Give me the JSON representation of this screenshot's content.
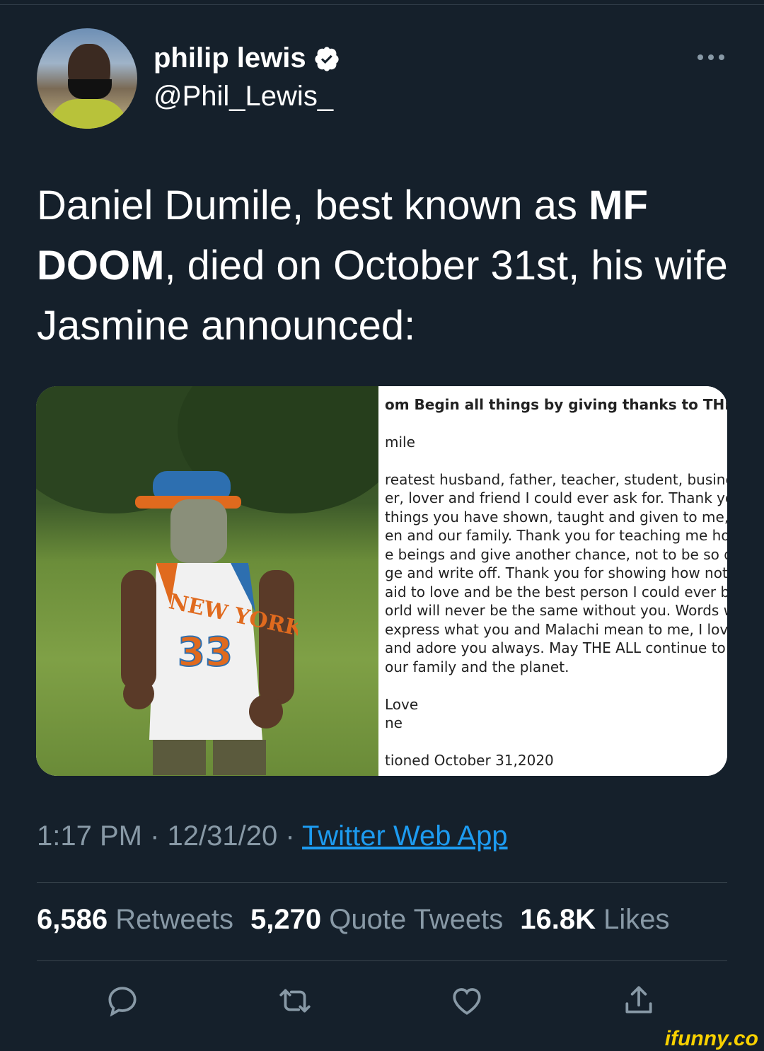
{
  "author": {
    "name": "philip lewis",
    "handle": "@Phil_Lewis_"
  },
  "tweet": {
    "text_1": "Daniel Dumile, best known as ",
    "text_bold": "MF DOOM",
    "text_2": ", died on October 31st, his wife Jasmine announced:"
  },
  "letter": {
    "lines": [
      "om Begin all things by giving thanks to THE ALL!",
      "mile",
      "reatest husband, father, teacher, student, business",
      "er, lover and friend I could ever ask for. Thank you f",
      " things you have shown, taught and given to me, ou",
      "en and our family. Thank you for teaching me how t",
      "e beings and give another chance, not to be so quic",
      "ge and write off. Thank you for showing how not to",
      "aid to love and be the best person I could ever be.",
      "orld will never be the same without you. Words will",
      " express what you and Malachi mean to me, I love",
      "and adore you always. May THE ALL continue to ble",
      "our family and the planet.",
      " Love",
      "ne",
      "tioned October 31,2020"
    ]
  },
  "photo": {
    "jersey_text": "NEW YORK",
    "jersey_number": "33"
  },
  "meta": {
    "time": "1:17 PM",
    "sep1": " · ",
    "date": "12/31/20",
    "sep2": " · ",
    "app": "Twitter Web App"
  },
  "stats": {
    "retweets_count": "6,586",
    "retweets_label": "Retweets",
    "quotes_count": "5,270",
    "quotes_label": "Quote Tweets",
    "likes_count": "16.8K",
    "likes_label": "Likes"
  },
  "watermark": "ifunny.co",
  "colors": {
    "background": "#15202b",
    "muted": "#8899a6",
    "link": "#1d9bf0",
    "divider": "#38444d"
  },
  "icons": [
    "verified-badge-icon",
    "more-icon",
    "reply-icon",
    "retweet-icon",
    "like-icon",
    "share-icon"
  ]
}
